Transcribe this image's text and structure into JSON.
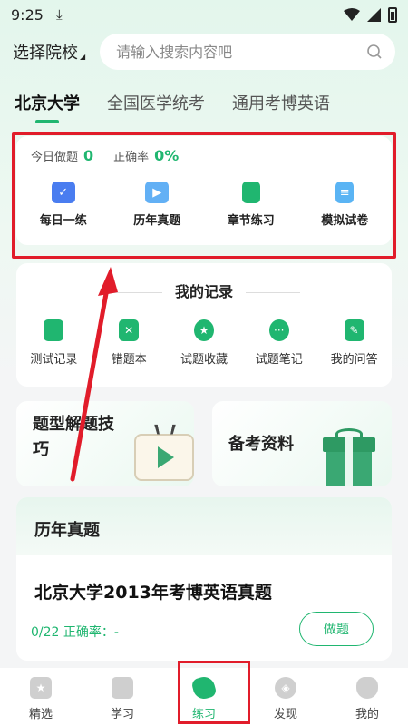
{
  "status_bar": {
    "time": "9:25",
    "download_icon": "download-icon"
  },
  "header": {
    "school_select": "选择院校",
    "search_placeholder": "请输入搜索内容吧"
  },
  "tabs": [
    "北京大学",
    "全国医学统考",
    "通用考博英语"
  ],
  "practice": {
    "today_label": "今日做题",
    "today_value": "0",
    "accuracy_label": "正确率",
    "accuracy_value": "0%",
    "items": [
      {
        "label": "每日一练",
        "icon": "calendar-check-icon",
        "color": "#4a7df0"
      },
      {
        "label": "历年真题",
        "icon": "play-video-icon",
        "color": "#62b0f5"
      },
      {
        "label": "章节练习",
        "icon": "bookmark-book-icon",
        "color": "#20b670"
      },
      {
        "label": "模拟试卷",
        "icon": "document-list-icon",
        "color": "#5ab4f4"
      }
    ]
  },
  "records": {
    "title": "我的记录",
    "items": [
      {
        "label": "测试记录",
        "icon": "test-record-icon"
      },
      {
        "label": "错题本",
        "icon": "wrong-questions-icon"
      },
      {
        "label": "试题收藏",
        "icon": "favorite-star-icon"
      },
      {
        "label": "试题笔记",
        "icon": "notes-bubble-icon"
      },
      {
        "label": "我的问答",
        "icon": "edit-qa-icon"
      }
    ]
  },
  "promos": {
    "left_title": "题型解题技巧",
    "right_title": "备考资料"
  },
  "history": {
    "section_title": "历年真题",
    "exam_title": "北京大学2013年考博英语真题",
    "progress": "0/22 正确率：-",
    "button": "做题"
  },
  "bottom_nav": [
    {
      "label": "精选",
      "icon": "featured-star-icon"
    },
    {
      "label": "学习",
      "icon": "book-open-icon"
    },
    {
      "label": "练习",
      "icon": "practice-leaf-icon"
    },
    {
      "label": "发现",
      "icon": "compass-icon"
    },
    {
      "label": "我的",
      "icon": "cat-profile-icon"
    }
  ],
  "colors": {
    "accent": "#20b670",
    "annotation": "#e11c2a"
  }
}
